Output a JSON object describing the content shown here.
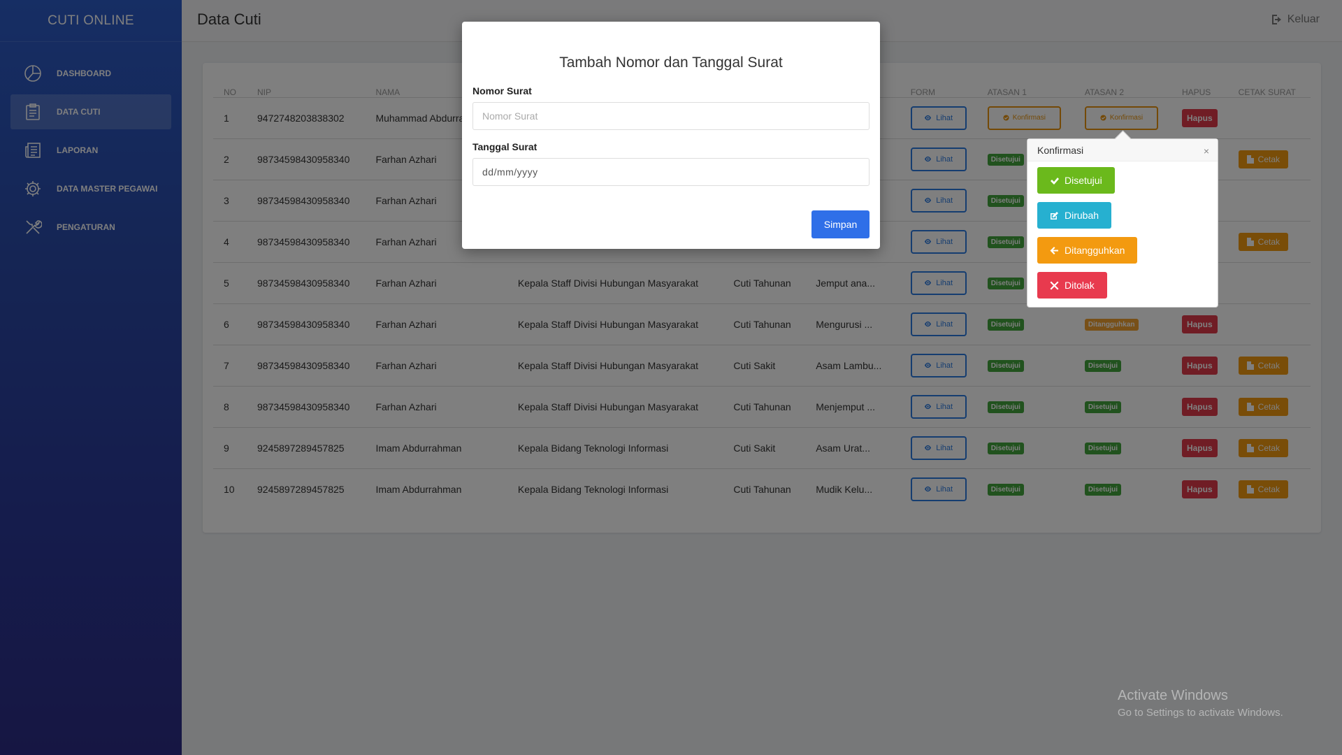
{
  "sidebar": {
    "brand": "CUTI ONLINE",
    "items": [
      {
        "label": "DASHBOARD",
        "icon": "dashboard-icon"
      },
      {
        "label": "DATA CUTI",
        "icon": "clipboard-icon",
        "active": true
      },
      {
        "label": "LAPORAN",
        "icon": "newspaper-icon"
      },
      {
        "label": "DATA MASTER PEGAWAI",
        "icon": "gear-icon"
      },
      {
        "label": "PENGATURAN",
        "icon": "tools-icon"
      }
    ]
  },
  "header": {
    "title": "Data Cuti",
    "logout_label": "Keluar"
  },
  "table": {
    "headers": [
      "NO",
      "NIP",
      "NAMA",
      "",
      "",
      "",
      "FORM",
      "ATASAN 1",
      "ATASAN 2",
      "HAPUS",
      "CETAK SURAT"
    ],
    "rows": [
      {
        "no": "1",
        "nip": "9472748203838302",
        "nama": "Muhammad Abdurrahman",
        "jabatan": "",
        "jenis": "",
        "alasan": "",
        "form": "Lihat",
        "atasan1": "Konfirmasi",
        "atasan2": "Konfirmasi",
        "hapus": "Hapus",
        "cetak": ""
      },
      {
        "no": "2",
        "nip": "98734598430958340",
        "nama": "Farhan Azhari",
        "jabatan": "",
        "jenis": "",
        "alasan": "",
        "form": "Lihat",
        "atasan1": "Disetujui",
        "atasan2": "",
        "hapus": "",
        "cetak": "Cetak"
      },
      {
        "no": "3",
        "nip": "98734598430958340",
        "nama": "Farhan Azhari",
        "jabatan": "",
        "jenis": "",
        "alasan": "",
        "form": "Lihat",
        "atasan1": "Disetujui",
        "atasan2": "",
        "hapus": "",
        "cetak": ""
      },
      {
        "no": "4",
        "nip": "98734598430958340",
        "nama": "Farhan Azhari",
        "jabatan": "",
        "jenis": "",
        "alasan": "",
        "form": "Lihat",
        "atasan1": "Disetujui",
        "atasan2": "",
        "hapus": "",
        "cetak": "Cetak"
      },
      {
        "no": "5",
        "nip": "98734598430958340",
        "nama": "Farhan Azhari",
        "jabatan": "Kepala Staff Divisi Hubungan Masyarakat",
        "jenis": "Cuti Tahunan",
        "alasan": "Jemput ana...",
        "form": "Lihat",
        "atasan1": "Disetujui",
        "atasan2": "",
        "hapus": "",
        "cetak": ""
      },
      {
        "no": "6",
        "nip": "98734598430958340",
        "nama": "Farhan Azhari",
        "jabatan": "Kepala Staff Divisi Hubungan Masyarakat",
        "jenis": "Cuti Tahunan",
        "alasan": "Mengurusi ...",
        "form": "Lihat",
        "atasan1": "Disetujui",
        "atasan2": "Ditangguhkan",
        "hapus": "Hapus",
        "cetak": ""
      },
      {
        "no": "7",
        "nip": "98734598430958340",
        "nama": "Farhan Azhari",
        "jabatan": "Kepala Staff Divisi Hubungan Masyarakat",
        "jenis": "Cuti Sakit",
        "alasan": "Asam Lambu...",
        "form": "Lihat",
        "atasan1": "Disetujui",
        "atasan2": "Disetujui",
        "hapus": "Hapus",
        "cetak": "Cetak"
      },
      {
        "no": "8",
        "nip": "98734598430958340",
        "nama": "Farhan Azhari",
        "jabatan": "Kepala Staff Divisi Hubungan Masyarakat",
        "jenis": "Cuti Tahunan",
        "alasan": "Menjemput ...",
        "form": "Lihat",
        "atasan1": "Disetujui",
        "atasan2": "Disetujui",
        "hapus": "Hapus",
        "cetak": "Cetak"
      },
      {
        "no": "9",
        "nip": "9245897289457825",
        "nama": "Imam Abdurrahman",
        "jabatan": "Kepala Bidang Teknologi Informasi",
        "jenis": "Cuti Sakit",
        "alasan": "Asam Urat...",
        "form": "Lihat",
        "atasan1": "Disetujui",
        "atasan2": "Disetujui",
        "hapus": "Hapus",
        "cetak": "Cetak"
      },
      {
        "no": "10",
        "nip": "9245897289457825",
        "nama": "Imam Abdurrahman",
        "jabatan": "Kepala Bidang Teknologi Informasi",
        "jenis": "Cuti Tahunan",
        "alasan": "Mudik Kelu...",
        "form": "Lihat",
        "atasan1": "Disetujui",
        "atasan2": "Disetujui",
        "hapus": "Hapus",
        "cetak": "Cetak"
      }
    ]
  },
  "popover": {
    "title": "Konfirmasi",
    "close": "×",
    "buttons": [
      {
        "label": "Disetujui",
        "icon": "check-icon",
        "color": "#6bb91c"
      },
      {
        "label": "Dirubah",
        "icon": "edit-icon",
        "color": "#26b0d0"
      },
      {
        "label": "Ditangguhkan",
        "icon": "arrow-left-icon",
        "color": "#f39a10"
      },
      {
        "label": "Ditolak",
        "icon": "x-icon",
        "color": "#e83a4e"
      }
    ]
  },
  "modal": {
    "title": "Tambah Nomor dan Tanggal Surat",
    "nomor_label": "Nomor Surat",
    "nomor_placeholder": "Nomor Surat",
    "tanggal_label": "Tanggal Surat",
    "tanggal_placeholder": "dd/mm/yyyy",
    "save_label": "Simpan"
  },
  "watermark": {
    "line1": "Activate Windows",
    "line2": "Go to Settings to activate Windows."
  },
  "colors": {
    "primary": "#2f6fe8",
    "danger": "#e03b4b",
    "warning": "#f39a10",
    "success": "#43a53c"
  }
}
